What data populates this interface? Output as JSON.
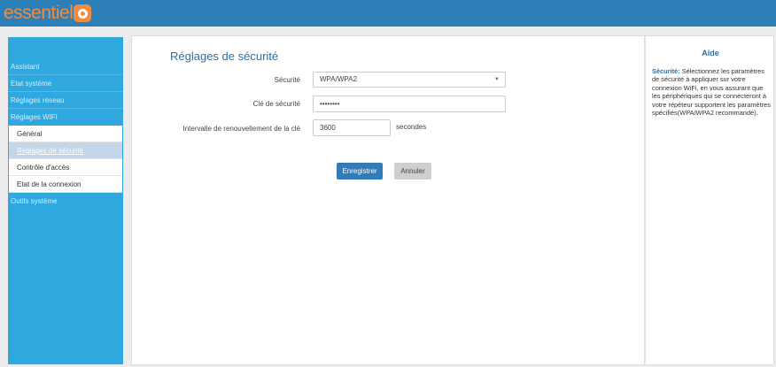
{
  "brand": {
    "logo_text": "essentiel"
  },
  "sidebar": {
    "items": [
      {
        "label": "Assistant"
      },
      {
        "label": "Etat système"
      },
      {
        "label": "Réglages réseau"
      },
      {
        "label": "Réglages WIFI"
      }
    ],
    "subitems": [
      {
        "label": "Général"
      },
      {
        "label": "Réglages de sécurité",
        "active": true
      },
      {
        "label": "Contrôle d'accès"
      },
      {
        "label": "Etat de la connexion"
      }
    ],
    "bottom_item": {
      "label": "Outils système"
    }
  },
  "form": {
    "title": "Réglages de sécurité",
    "security_label": "Sécurité",
    "security_value": "WPA/WPA2",
    "key_label": "Clé de sécurité",
    "key_value": "••••••••",
    "interval_label": "Intervalle de renouvellement de la clé",
    "interval_value": "3600",
    "interval_unit": "secondes",
    "save_label": "Enregistrer",
    "cancel_label": "Annuler"
  },
  "help": {
    "title": "Aide",
    "term": "Sécurité:",
    "text": " Sélectionnez les paramètres de sécurité à appliquer sur votre connexion WiFi, en vous assurant que les périphériques qui se connecteront à votre répéteur supportent les paramètres spécifiés(WPA/WPA2 recommandé)."
  },
  "colors": {
    "header": "#2d7fb8",
    "sidebar": "#2fa8e0",
    "accent_blue": "#2a6fa8",
    "brand_orange": "#f28b3c",
    "save_button": "#337ab7"
  }
}
